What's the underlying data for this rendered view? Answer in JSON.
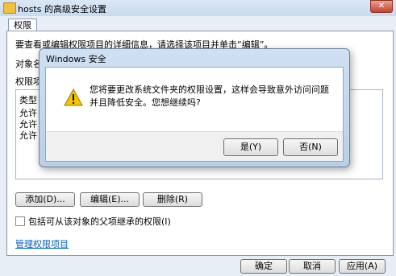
{
  "window": {
    "title": "hosts 的高级安全设置",
    "close_glyph": "✕"
  },
  "tabs": [
    {
      "label": "权限"
    }
  ],
  "main": {
    "description": "要查看或编辑权限项目的详细信息，请选择该项目并单击“编辑”。",
    "object_label": "对象名",
    "permissions_label": "权限项",
    "list_header": "类型",
    "rows": [
      "允许",
      "允许",
      "允许"
    ],
    "buttons": {
      "add": "添加(D)...",
      "edit": "编辑(E)...",
      "delete": "删除(R)"
    },
    "inherit_label": "包括可从该对象的父项继承的权限(I)",
    "manage_link": "管理权限项目"
  },
  "footer_buttons": {
    "ok": "确定",
    "cancel": "取消",
    "apply": "应用(A)"
  },
  "dialog": {
    "title": "Windows 安全",
    "message": "您将要更改系统文件夹的权限设置，这样会导致意外访问问题并且降低安全。您想继续吗?",
    "yes": "是(Y)",
    "no": "否(N)",
    "icon": "warning-icon"
  }
}
